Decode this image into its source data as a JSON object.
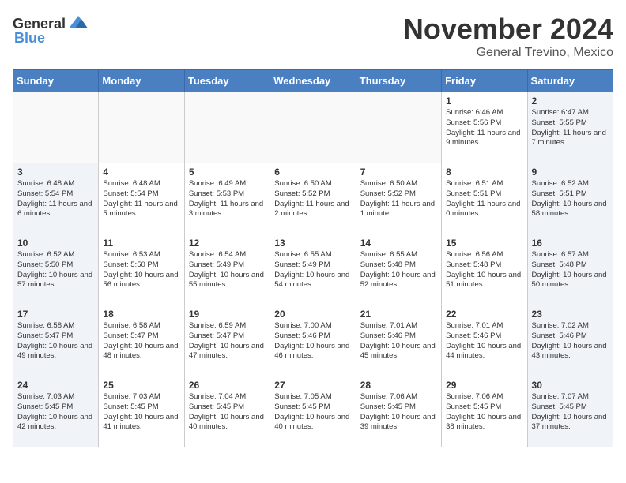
{
  "header": {
    "logo_general": "General",
    "logo_blue": "Blue",
    "title": "November 2024",
    "subtitle": "General Trevino, Mexico"
  },
  "calendar": {
    "days_of_week": [
      "Sunday",
      "Monday",
      "Tuesday",
      "Wednesday",
      "Thursday",
      "Friday",
      "Saturday"
    ],
    "weeks": [
      [
        {
          "day": "",
          "sunrise": "",
          "sunset": "",
          "daylight": "",
          "weekend": false,
          "empty": true
        },
        {
          "day": "",
          "sunrise": "",
          "sunset": "",
          "daylight": "",
          "weekend": false,
          "empty": true
        },
        {
          "day": "",
          "sunrise": "",
          "sunset": "",
          "daylight": "",
          "weekend": false,
          "empty": true
        },
        {
          "day": "",
          "sunrise": "",
          "sunset": "",
          "daylight": "",
          "weekend": false,
          "empty": true
        },
        {
          "day": "",
          "sunrise": "",
          "sunset": "",
          "daylight": "",
          "weekend": false,
          "empty": true
        },
        {
          "day": "1",
          "sunrise": "Sunrise: 6:46 AM",
          "sunset": "Sunset: 5:56 PM",
          "daylight": "Daylight: 11 hours and 9 minutes.",
          "weekend": false,
          "empty": false
        },
        {
          "day": "2",
          "sunrise": "Sunrise: 6:47 AM",
          "sunset": "Sunset: 5:55 PM",
          "daylight": "Daylight: 11 hours and 7 minutes.",
          "weekend": true,
          "empty": false
        }
      ],
      [
        {
          "day": "3",
          "sunrise": "Sunrise: 6:48 AM",
          "sunset": "Sunset: 5:54 PM",
          "daylight": "Daylight: 11 hours and 6 minutes.",
          "weekend": false,
          "empty": false
        },
        {
          "day": "4",
          "sunrise": "Sunrise: 6:48 AM",
          "sunset": "Sunset: 5:54 PM",
          "daylight": "Daylight: 11 hours and 5 minutes.",
          "weekend": false,
          "empty": false
        },
        {
          "day": "5",
          "sunrise": "Sunrise: 6:49 AM",
          "sunset": "Sunset: 5:53 PM",
          "daylight": "Daylight: 11 hours and 3 minutes.",
          "weekend": false,
          "empty": false
        },
        {
          "day": "6",
          "sunrise": "Sunrise: 6:50 AM",
          "sunset": "Sunset: 5:52 PM",
          "daylight": "Daylight: 11 hours and 2 minutes.",
          "weekend": false,
          "empty": false
        },
        {
          "day": "7",
          "sunrise": "Sunrise: 6:50 AM",
          "sunset": "Sunset: 5:52 PM",
          "daylight": "Daylight: 11 hours and 1 minute.",
          "weekend": false,
          "empty": false
        },
        {
          "day": "8",
          "sunrise": "Sunrise: 6:51 AM",
          "sunset": "Sunset: 5:51 PM",
          "daylight": "Daylight: 11 hours and 0 minutes.",
          "weekend": false,
          "empty": false
        },
        {
          "day": "9",
          "sunrise": "Sunrise: 6:52 AM",
          "sunset": "Sunset: 5:51 PM",
          "daylight": "Daylight: 10 hours and 58 minutes.",
          "weekend": true,
          "empty": false
        }
      ],
      [
        {
          "day": "10",
          "sunrise": "Sunrise: 6:52 AM",
          "sunset": "Sunset: 5:50 PM",
          "daylight": "Daylight: 10 hours and 57 minutes.",
          "weekend": false,
          "empty": false
        },
        {
          "day": "11",
          "sunrise": "Sunrise: 6:53 AM",
          "sunset": "Sunset: 5:50 PM",
          "daylight": "Daylight: 10 hours and 56 minutes.",
          "weekend": false,
          "empty": false
        },
        {
          "day": "12",
          "sunrise": "Sunrise: 6:54 AM",
          "sunset": "Sunset: 5:49 PM",
          "daylight": "Daylight: 10 hours and 55 minutes.",
          "weekend": false,
          "empty": false
        },
        {
          "day": "13",
          "sunrise": "Sunrise: 6:55 AM",
          "sunset": "Sunset: 5:49 PM",
          "daylight": "Daylight: 10 hours and 54 minutes.",
          "weekend": false,
          "empty": false
        },
        {
          "day": "14",
          "sunrise": "Sunrise: 6:55 AM",
          "sunset": "Sunset: 5:48 PM",
          "daylight": "Daylight: 10 hours and 52 minutes.",
          "weekend": false,
          "empty": false
        },
        {
          "day": "15",
          "sunrise": "Sunrise: 6:56 AM",
          "sunset": "Sunset: 5:48 PM",
          "daylight": "Daylight: 10 hours and 51 minutes.",
          "weekend": false,
          "empty": false
        },
        {
          "day": "16",
          "sunrise": "Sunrise: 6:57 AM",
          "sunset": "Sunset: 5:48 PM",
          "daylight": "Daylight: 10 hours and 50 minutes.",
          "weekend": true,
          "empty": false
        }
      ],
      [
        {
          "day": "17",
          "sunrise": "Sunrise: 6:58 AM",
          "sunset": "Sunset: 5:47 PM",
          "daylight": "Daylight: 10 hours and 49 minutes.",
          "weekend": false,
          "empty": false
        },
        {
          "day": "18",
          "sunrise": "Sunrise: 6:58 AM",
          "sunset": "Sunset: 5:47 PM",
          "daylight": "Daylight: 10 hours and 48 minutes.",
          "weekend": false,
          "empty": false
        },
        {
          "day": "19",
          "sunrise": "Sunrise: 6:59 AM",
          "sunset": "Sunset: 5:47 PM",
          "daylight": "Daylight: 10 hours and 47 minutes.",
          "weekend": false,
          "empty": false
        },
        {
          "day": "20",
          "sunrise": "Sunrise: 7:00 AM",
          "sunset": "Sunset: 5:46 PM",
          "daylight": "Daylight: 10 hours and 46 minutes.",
          "weekend": false,
          "empty": false
        },
        {
          "day": "21",
          "sunrise": "Sunrise: 7:01 AM",
          "sunset": "Sunset: 5:46 PM",
          "daylight": "Daylight: 10 hours and 45 minutes.",
          "weekend": false,
          "empty": false
        },
        {
          "day": "22",
          "sunrise": "Sunrise: 7:01 AM",
          "sunset": "Sunset: 5:46 PM",
          "daylight": "Daylight: 10 hours and 44 minutes.",
          "weekend": false,
          "empty": false
        },
        {
          "day": "23",
          "sunrise": "Sunrise: 7:02 AM",
          "sunset": "Sunset: 5:46 PM",
          "daylight": "Daylight: 10 hours and 43 minutes.",
          "weekend": true,
          "empty": false
        }
      ],
      [
        {
          "day": "24",
          "sunrise": "Sunrise: 7:03 AM",
          "sunset": "Sunset: 5:45 PM",
          "daylight": "Daylight: 10 hours and 42 minutes.",
          "weekend": false,
          "empty": false
        },
        {
          "day": "25",
          "sunrise": "Sunrise: 7:03 AM",
          "sunset": "Sunset: 5:45 PM",
          "daylight": "Daylight: 10 hours and 41 minutes.",
          "weekend": false,
          "empty": false
        },
        {
          "day": "26",
          "sunrise": "Sunrise: 7:04 AM",
          "sunset": "Sunset: 5:45 PM",
          "daylight": "Daylight: 10 hours and 40 minutes.",
          "weekend": false,
          "empty": false
        },
        {
          "day": "27",
          "sunrise": "Sunrise: 7:05 AM",
          "sunset": "Sunset: 5:45 PM",
          "daylight": "Daylight: 10 hours and 40 minutes.",
          "weekend": false,
          "empty": false
        },
        {
          "day": "28",
          "sunrise": "Sunrise: 7:06 AM",
          "sunset": "Sunset: 5:45 PM",
          "daylight": "Daylight: 10 hours and 39 minutes.",
          "weekend": false,
          "empty": false
        },
        {
          "day": "29",
          "sunrise": "Sunrise: 7:06 AM",
          "sunset": "Sunset: 5:45 PM",
          "daylight": "Daylight: 10 hours and 38 minutes.",
          "weekend": false,
          "empty": false
        },
        {
          "day": "30",
          "sunrise": "Sunrise: 7:07 AM",
          "sunset": "Sunset: 5:45 PM",
          "daylight": "Daylight: 10 hours and 37 minutes.",
          "weekend": true,
          "empty": false
        }
      ]
    ]
  }
}
